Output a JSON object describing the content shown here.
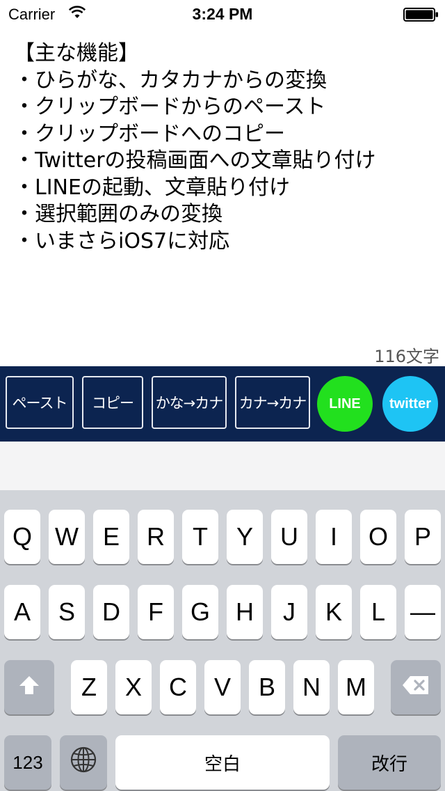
{
  "status_bar": {
    "carrier": "Carrier",
    "time": "3:24 PM"
  },
  "text_area": {
    "lines": [
      "【主な機能】",
      "・ひらがな、カタカナからの変換",
      "・クリップボードからのペースト",
      "・クリップボードへのコピー",
      "・Twitterの投稿画面への文章貼り付け",
      "・LINEの起動、文章貼り付け",
      "・選択範囲のみの変換",
      "・いまさらiOS7に対応"
    ],
    "char_count": "116文字"
  },
  "toolbar": {
    "paste_label": "ペースト",
    "copy_label": "コピー",
    "kana_to_kata_label": "かな→カナ",
    "kata_to_kata_label": "カナ→カナ",
    "line_label": "LINE",
    "twitter_label": "twitter",
    "colors": {
      "background": "#0c2450",
      "line": "#22e01e",
      "twitter": "#1ec4f4"
    }
  },
  "keyboard": {
    "row1": [
      "Q",
      "W",
      "E",
      "R",
      "T",
      "Y",
      "U",
      "I",
      "O",
      "P"
    ],
    "row2": [
      "A",
      "S",
      "D",
      "F",
      "G",
      "H",
      "J",
      "K",
      "L",
      "—"
    ],
    "row3": [
      "Z",
      "X",
      "C",
      "V",
      "B",
      "N",
      "M"
    ],
    "numbers_label": "123",
    "space_label": "空白",
    "return_label": "改行",
    "shift_icon": "shift-arrow-icon",
    "delete_icon": "delete-backspace-icon",
    "globe_icon": "globe-icon"
  }
}
